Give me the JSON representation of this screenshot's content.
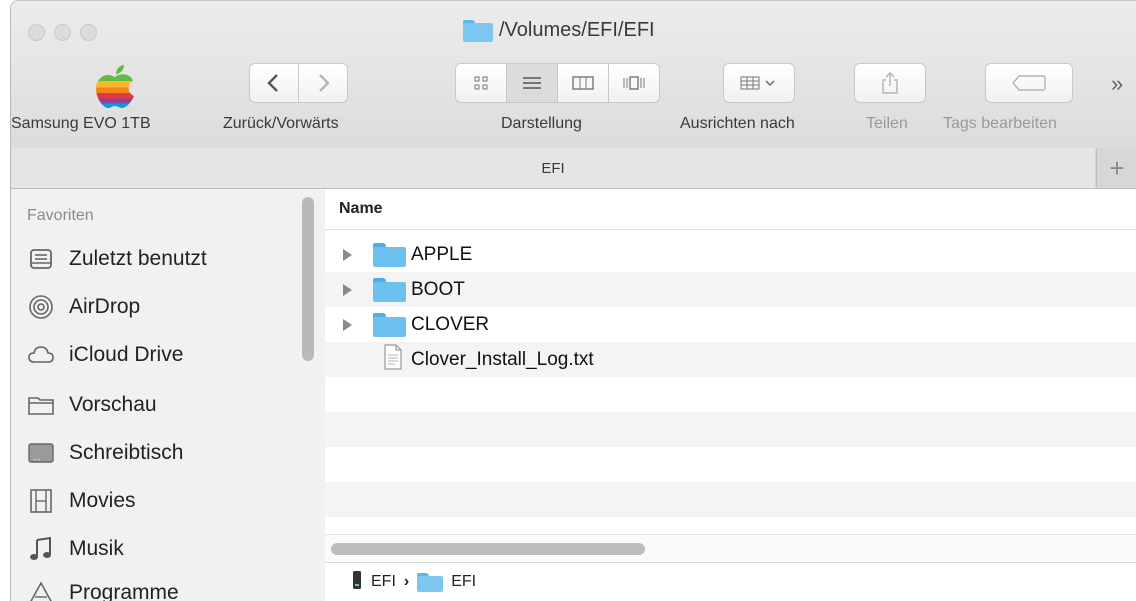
{
  "window": {
    "title": "/Volumes/EFI/EFI",
    "title_icon": "folder-icon"
  },
  "toolbar": {
    "device_label": "Samsung EVO 1TB",
    "device_icon": "apple-rainbow-logo",
    "nav_label": "Zurück/Vorwärts",
    "view_label": "Darstellung",
    "arrange_label": "Ausrichten nach",
    "share_label": "Teilen",
    "tags_label": "Tags bearbeiten",
    "overflow": "»",
    "view_modes": [
      "icon-view",
      "list-view",
      "column-view",
      "cover-flow-view"
    ],
    "selected_view": "list-view"
  },
  "tabs": {
    "active": "EFI",
    "add": "+"
  },
  "sidebar": {
    "heading": "Favoriten",
    "items": [
      {
        "label": "Zuletzt benutzt",
        "icon": "recents-icon"
      },
      {
        "label": "AirDrop",
        "icon": "airdrop-icon"
      },
      {
        "label": "iCloud Drive",
        "icon": "cloud-icon"
      },
      {
        "label": "Vorschau",
        "icon": "folder-icon"
      },
      {
        "label": "Schreibtisch",
        "icon": "desktop-icon"
      },
      {
        "label": "Movies",
        "icon": "film-icon"
      },
      {
        "label": "Musik",
        "icon": "music-icon"
      },
      {
        "label": "Programme",
        "icon": "applications-icon"
      }
    ]
  },
  "file_list": {
    "column_header": "Name",
    "rows": [
      {
        "name": "APPLE",
        "kind": "folder"
      },
      {
        "name": "BOOT",
        "kind": "folder"
      },
      {
        "name": "CLOVER",
        "kind": "folder"
      },
      {
        "name": "Clover_Install_Log.txt",
        "kind": "text-file"
      }
    ]
  },
  "path_bar": {
    "segments": [
      "EFI",
      "EFI"
    ],
    "separator": "›"
  },
  "colors": {
    "folder": "#6cc1ee",
    "window_chrome": "#e4e4e4",
    "sidebar_bg": "#f1f1f1"
  }
}
